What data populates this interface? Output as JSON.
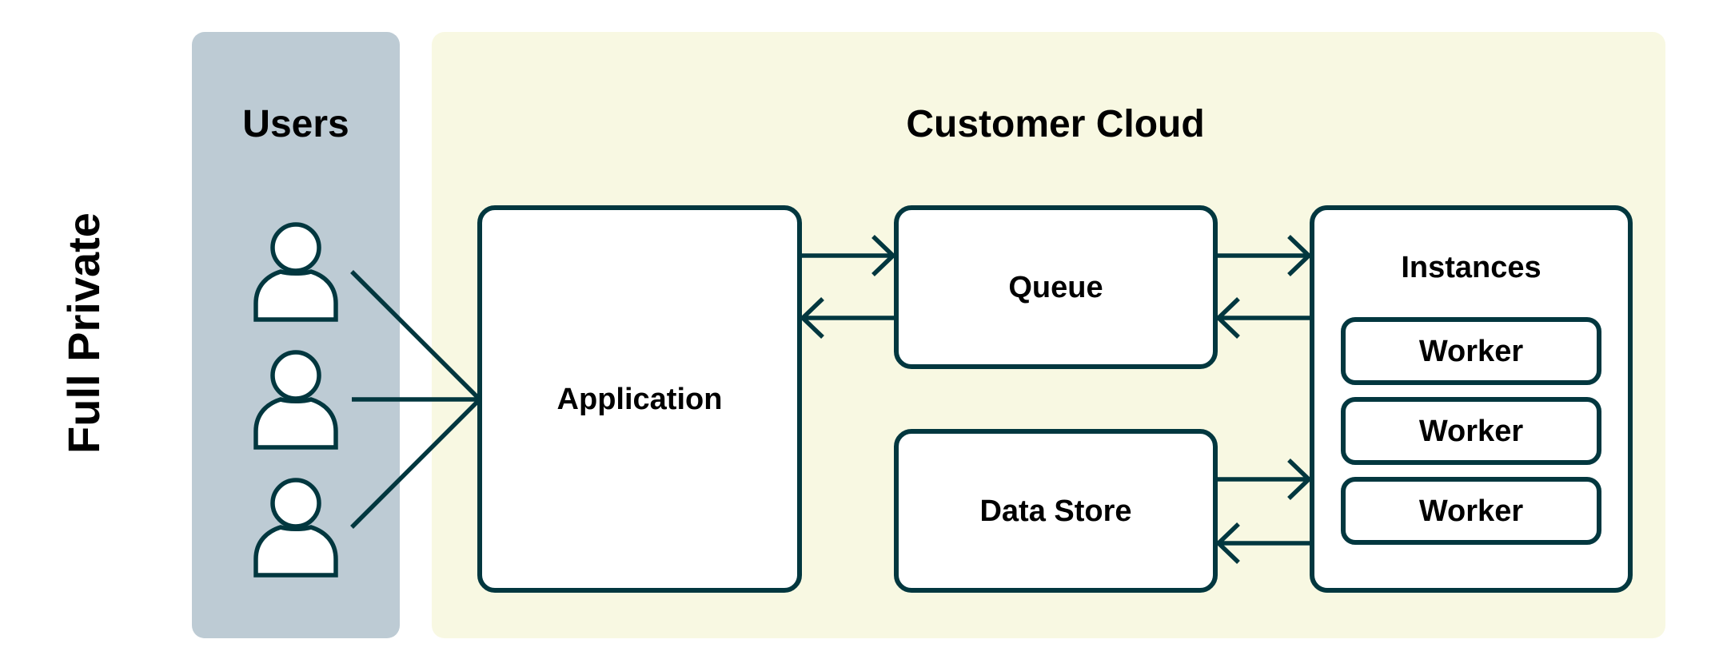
{
  "side_label": "Full Private",
  "users_panel": {
    "title": "Users",
    "user_count": 3
  },
  "cloud_panel": {
    "title": "Customer Cloud",
    "application": {
      "label": "Application"
    },
    "queue": {
      "label": "Queue"
    },
    "data_store": {
      "label": "Data Store"
    },
    "instances": {
      "label": "Instances",
      "workers": [
        {
          "label": "Worker"
        },
        {
          "label": "Worker"
        },
        {
          "label": "Worker"
        }
      ]
    }
  },
  "connections": [
    {
      "from": "User 1",
      "to": "Application",
      "arrow": "none"
    },
    {
      "from": "User 2",
      "to": "Application",
      "arrow": "none"
    },
    {
      "from": "User 3",
      "to": "Application",
      "arrow": "none"
    },
    {
      "from": "Application",
      "to": "Queue",
      "arrow": "forward"
    },
    {
      "from": "Queue",
      "to": "Application",
      "arrow": "forward"
    },
    {
      "from": "Queue",
      "to": "Instances",
      "arrow": "forward"
    },
    {
      "from": "Instances",
      "to": "Queue",
      "arrow": "forward"
    },
    {
      "from": "Data Store",
      "to": "Instances",
      "arrow": "forward"
    },
    {
      "from": "Instances",
      "to": "Data Store",
      "arrow": "forward"
    }
  ],
  "colors": {
    "stroke": "#02373F",
    "users_panel_bg": "#BDCBD4",
    "cloud_panel_bg": "#F8F8E2",
    "box_bg": "#FFFFFF",
    "text": "#000000"
  }
}
